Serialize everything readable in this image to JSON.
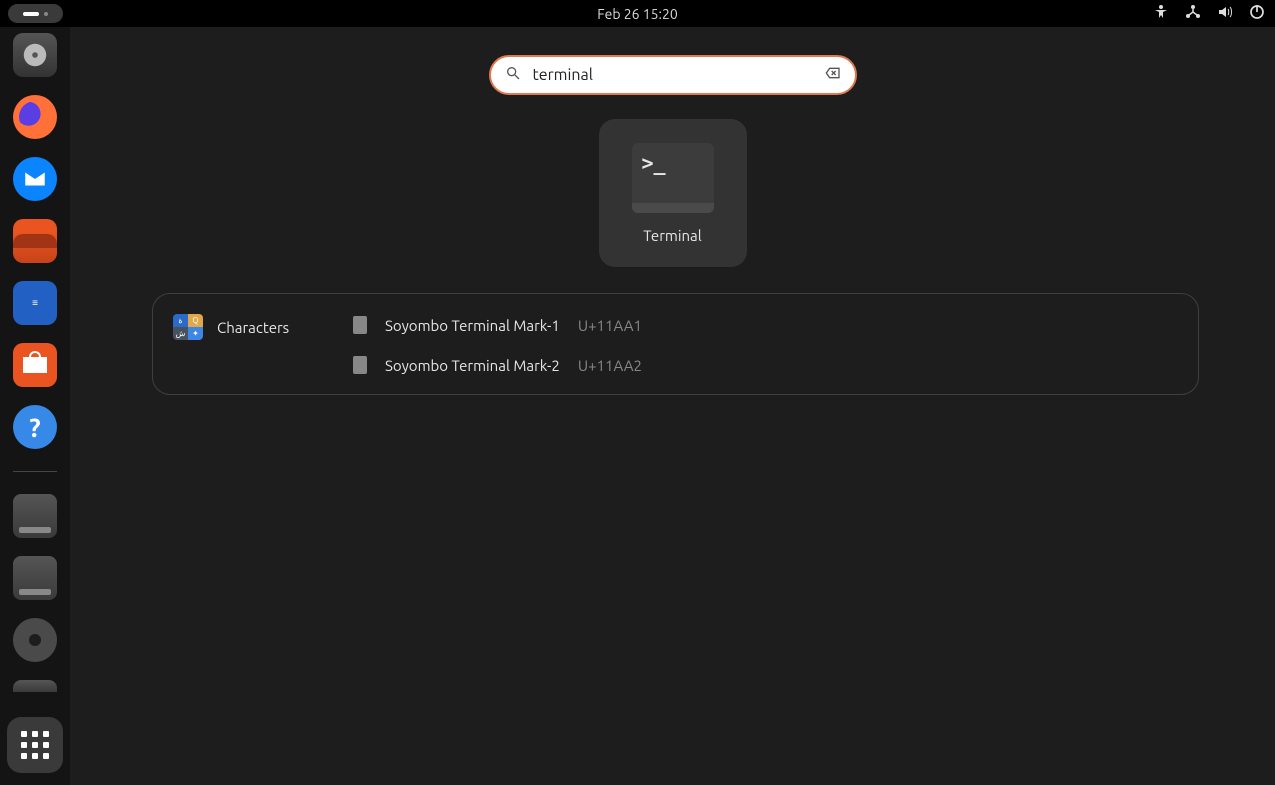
{
  "topbar": {
    "datetime": "Feb 26  15:20"
  },
  "search": {
    "value": "terminal"
  },
  "app_result": {
    "label": "Terminal",
    "prompt": ">_"
  },
  "characters_section": {
    "label": "Characters",
    "items": [
      {
        "name": "Soyombo Terminal Mark-1",
        "code": "U+11AA1"
      },
      {
        "name": "Soyombo Terminal Mark-2",
        "code": "U+11AA2"
      }
    ]
  },
  "dock": {
    "items": [
      {
        "name": "disks"
      },
      {
        "name": "firefox"
      },
      {
        "name": "thunderbird"
      },
      {
        "name": "files"
      },
      {
        "name": "writer"
      },
      {
        "name": "software"
      },
      {
        "name": "help"
      }
    ],
    "mounts": [
      {
        "name": "drive-1"
      },
      {
        "name": "drive-2"
      },
      {
        "name": "cd"
      },
      {
        "name": "partial"
      }
    ],
    "help_glyph": "?"
  },
  "writer_lines": "≡"
}
